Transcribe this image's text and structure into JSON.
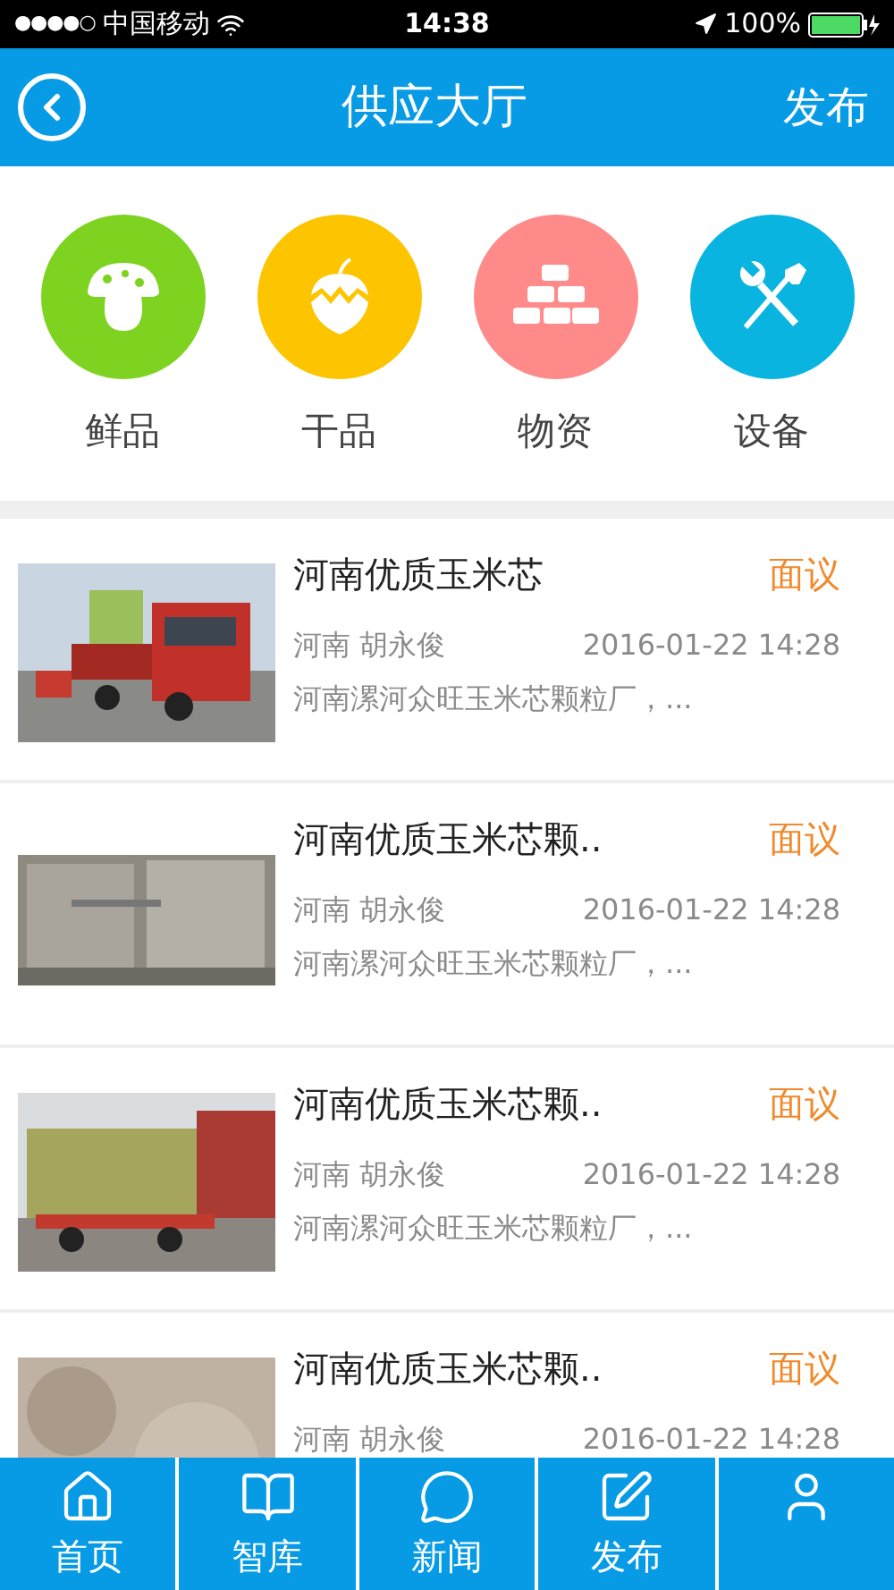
{
  "status_bar": {
    "signal": "●●●●○",
    "carrier": "中国移动",
    "time": "14:38",
    "battery": "100%"
  },
  "header": {
    "title": "供应大厅",
    "action": "发布"
  },
  "categories": [
    {
      "kind": "mushroom",
      "label": "鲜品",
      "color": "#7ed321"
    },
    {
      "kind": "acorn",
      "label": "干品",
      "color": "#fdc400"
    },
    {
      "kind": "bricks",
      "label": "物资",
      "color": "#ff8a8a"
    },
    {
      "kind": "tools",
      "label": "设备",
      "color": "#0ab4e0"
    }
  ],
  "listings": [
    {
      "title": "河南优质玉米芯",
      "price": "面议",
      "location": "河南 胡永俊",
      "date": "2016-01-22 14:28",
      "description": "河南漯河众旺玉米芯颗粒厂，..."
    },
    {
      "title": "河南优质玉米芯颗..",
      "price": "面议",
      "location": "河南 胡永俊",
      "date": "2016-01-22 14:28",
      "description": "河南漯河众旺玉米芯颗粒厂，..."
    },
    {
      "title": "河南优质玉米芯颗..",
      "price": "面议",
      "location": "河南 胡永俊",
      "date": "2016-01-22 14:28",
      "description": "河南漯河众旺玉米芯颗粒厂，..."
    },
    {
      "title": "河南优质玉米芯颗..",
      "price": "面议",
      "location": "河南 胡永俊",
      "date": "2016-01-22 14:28"
    }
  ],
  "tab_bar": [
    {
      "kind": "home",
      "label": "首页"
    },
    {
      "kind": "book",
      "label": "智库"
    },
    {
      "kind": "chat",
      "label": "新闻"
    },
    {
      "kind": "edit",
      "label": "发布"
    },
    {
      "kind": "user"
    }
  ]
}
